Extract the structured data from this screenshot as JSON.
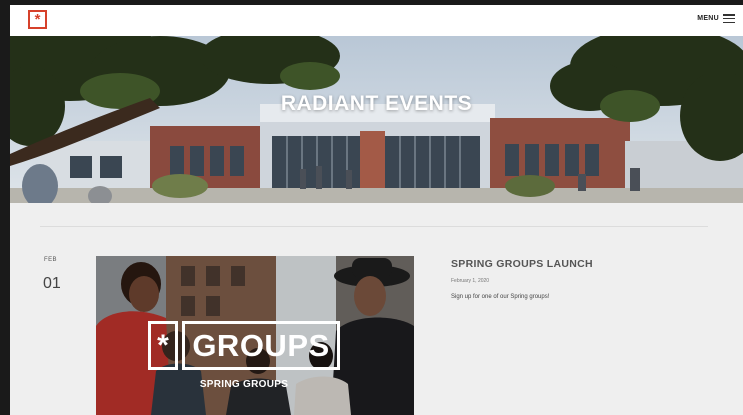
{
  "header": {
    "logo_glyph": "*",
    "menu_label": "MENU",
    "brand_color": "#d6412b"
  },
  "hero": {
    "title": "RADIANT EVENTS"
  },
  "events": [
    {
      "month": "FEB",
      "day": "01",
      "image": {
        "logo_glyph": "*",
        "word": "GROUPS",
        "subtitle": "SPRING GROUPS"
      },
      "title": "SPRING GROUPS LAUNCH",
      "date": "February 1, 2020",
      "description": "Sign up for one of our Spring groups!"
    }
  ]
}
